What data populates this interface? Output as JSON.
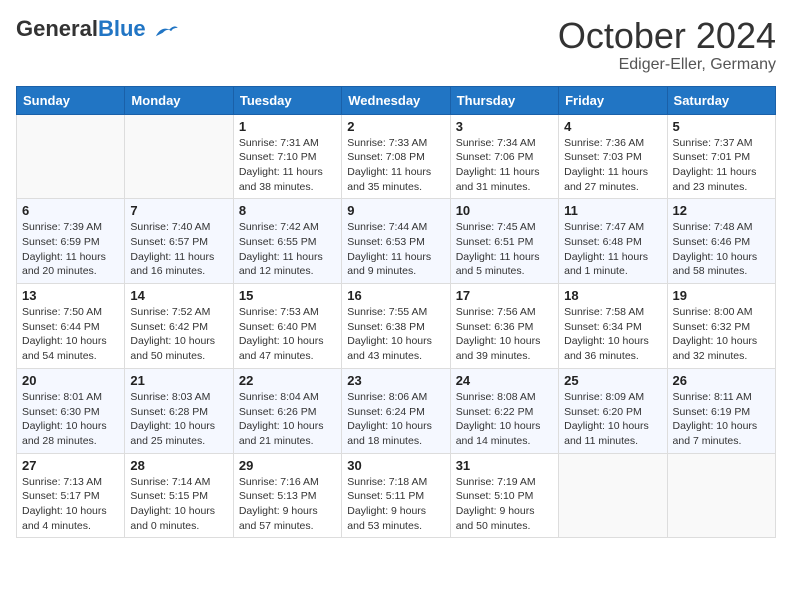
{
  "header": {
    "logo_general": "General",
    "logo_blue": "Blue",
    "month_year": "October 2024",
    "location": "Ediger-Eller, Germany"
  },
  "weekdays": [
    "Sunday",
    "Monday",
    "Tuesday",
    "Wednesday",
    "Thursday",
    "Friday",
    "Saturday"
  ],
  "weeks": [
    [
      {
        "day": "",
        "sunrise": "",
        "sunset": "",
        "daylight": ""
      },
      {
        "day": "",
        "sunrise": "",
        "sunset": "",
        "daylight": ""
      },
      {
        "day": "1",
        "sunrise": "Sunrise: 7:31 AM",
        "sunset": "Sunset: 7:10 PM",
        "daylight": "Daylight: 11 hours and 38 minutes."
      },
      {
        "day": "2",
        "sunrise": "Sunrise: 7:33 AM",
        "sunset": "Sunset: 7:08 PM",
        "daylight": "Daylight: 11 hours and 35 minutes."
      },
      {
        "day": "3",
        "sunrise": "Sunrise: 7:34 AM",
        "sunset": "Sunset: 7:06 PM",
        "daylight": "Daylight: 11 hours and 31 minutes."
      },
      {
        "day": "4",
        "sunrise": "Sunrise: 7:36 AM",
        "sunset": "Sunset: 7:03 PM",
        "daylight": "Daylight: 11 hours and 27 minutes."
      },
      {
        "day": "5",
        "sunrise": "Sunrise: 7:37 AM",
        "sunset": "Sunset: 7:01 PM",
        "daylight": "Daylight: 11 hours and 23 minutes."
      }
    ],
    [
      {
        "day": "6",
        "sunrise": "Sunrise: 7:39 AM",
        "sunset": "Sunset: 6:59 PM",
        "daylight": "Daylight: 11 hours and 20 minutes."
      },
      {
        "day": "7",
        "sunrise": "Sunrise: 7:40 AM",
        "sunset": "Sunset: 6:57 PM",
        "daylight": "Daylight: 11 hours and 16 minutes."
      },
      {
        "day": "8",
        "sunrise": "Sunrise: 7:42 AM",
        "sunset": "Sunset: 6:55 PM",
        "daylight": "Daylight: 11 hours and 12 minutes."
      },
      {
        "day": "9",
        "sunrise": "Sunrise: 7:44 AM",
        "sunset": "Sunset: 6:53 PM",
        "daylight": "Daylight: 11 hours and 9 minutes."
      },
      {
        "day": "10",
        "sunrise": "Sunrise: 7:45 AM",
        "sunset": "Sunset: 6:51 PM",
        "daylight": "Daylight: 11 hours and 5 minutes."
      },
      {
        "day": "11",
        "sunrise": "Sunrise: 7:47 AM",
        "sunset": "Sunset: 6:48 PM",
        "daylight": "Daylight: 11 hours and 1 minute."
      },
      {
        "day": "12",
        "sunrise": "Sunrise: 7:48 AM",
        "sunset": "Sunset: 6:46 PM",
        "daylight": "Daylight: 10 hours and 58 minutes."
      }
    ],
    [
      {
        "day": "13",
        "sunrise": "Sunrise: 7:50 AM",
        "sunset": "Sunset: 6:44 PM",
        "daylight": "Daylight: 10 hours and 54 minutes."
      },
      {
        "day": "14",
        "sunrise": "Sunrise: 7:52 AM",
        "sunset": "Sunset: 6:42 PM",
        "daylight": "Daylight: 10 hours and 50 minutes."
      },
      {
        "day": "15",
        "sunrise": "Sunrise: 7:53 AM",
        "sunset": "Sunset: 6:40 PM",
        "daylight": "Daylight: 10 hours and 47 minutes."
      },
      {
        "day": "16",
        "sunrise": "Sunrise: 7:55 AM",
        "sunset": "Sunset: 6:38 PM",
        "daylight": "Daylight: 10 hours and 43 minutes."
      },
      {
        "day": "17",
        "sunrise": "Sunrise: 7:56 AM",
        "sunset": "Sunset: 6:36 PM",
        "daylight": "Daylight: 10 hours and 39 minutes."
      },
      {
        "day": "18",
        "sunrise": "Sunrise: 7:58 AM",
        "sunset": "Sunset: 6:34 PM",
        "daylight": "Daylight: 10 hours and 36 minutes."
      },
      {
        "day": "19",
        "sunrise": "Sunrise: 8:00 AM",
        "sunset": "Sunset: 6:32 PM",
        "daylight": "Daylight: 10 hours and 32 minutes."
      }
    ],
    [
      {
        "day": "20",
        "sunrise": "Sunrise: 8:01 AM",
        "sunset": "Sunset: 6:30 PM",
        "daylight": "Daylight: 10 hours and 28 minutes."
      },
      {
        "day": "21",
        "sunrise": "Sunrise: 8:03 AM",
        "sunset": "Sunset: 6:28 PM",
        "daylight": "Daylight: 10 hours and 25 minutes."
      },
      {
        "day": "22",
        "sunrise": "Sunrise: 8:04 AM",
        "sunset": "Sunset: 6:26 PM",
        "daylight": "Daylight: 10 hours and 21 minutes."
      },
      {
        "day": "23",
        "sunrise": "Sunrise: 8:06 AM",
        "sunset": "Sunset: 6:24 PM",
        "daylight": "Daylight: 10 hours and 18 minutes."
      },
      {
        "day": "24",
        "sunrise": "Sunrise: 8:08 AM",
        "sunset": "Sunset: 6:22 PM",
        "daylight": "Daylight: 10 hours and 14 minutes."
      },
      {
        "day": "25",
        "sunrise": "Sunrise: 8:09 AM",
        "sunset": "Sunset: 6:20 PM",
        "daylight": "Daylight: 10 hours and 11 minutes."
      },
      {
        "day": "26",
        "sunrise": "Sunrise: 8:11 AM",
        "sunset": "Sunset: 6:19 PM",
        "daylight": "Daylight: 10 hours and 7 minutes."
      }
    ],
    [
      {
        "day": "27",
        "sunrise": "Sunrise: 7:13 AM",
        "sunset": "Sunset: 5:17 PM",
        "daylight": "Daylight: 10 hours and 4 minutes."
      },
      {
        "day": "28",
        "sunrise": "Sunrise: 7:14 AM",
        "sunset": "Sunset: 5:15 PM",
        "daylight": "Daylight: 10 hours and 0 minutes."
      },
      {
        "day": "29",
        "sunrise": "Sunrise: 7:16 AM",
        "sunset": "Sunset: 5:13 PM",
        "daylight": "Daylight: 9 hours and 57 minutes."
      },
      {
        "day": "30",
        "sunrise": "Sunrise: 7:18 AM",
        "sunset": "Sunset: 5:11 PM",
        "daylight": "Daylight: 9 hours and 53 minutes."
      },
      {
        "day": "31",
        "sunrise": "Sunrise: 7:19 AM",
        "sunset": "Sunset: 5:10 PM",
        "daylight": "Daylight: 9 hours and 50 minutes."
      },
      {
        "day": "",
        "sunrise": "",
        "sunset": "",
        "daylight": ""
      },
      {
        "day": "",
        "sunrise": "",
        "sunset": "",
        "daylight": ""
      }
    ]
  ]
}
